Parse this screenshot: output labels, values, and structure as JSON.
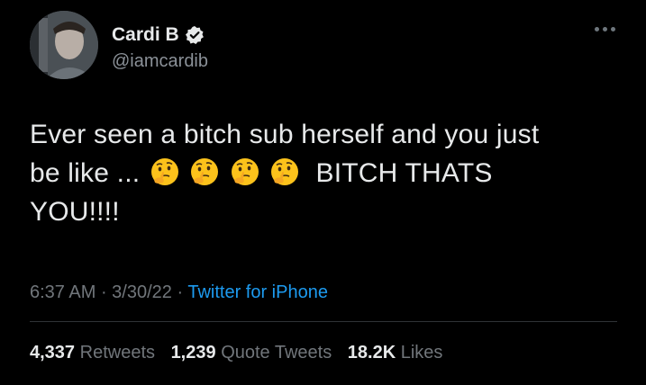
{
  "author": {
    "display_name": "Cardi B",
    "handle": "@iamcardib",
    "verified": true,
    "avatar": "avatar-photo"
  },
  "tweet": {
    "line1": "Ever seen a bitch sub herself and you just",
    "line2_prefix": "be like ...",
    "emojis": [
      "thinking-face",
      "thinking-face",
      "thinking-face",
      "thinking-face"
    ],
    "line2_suffix": " BITCH THATS",
    "line3": "YOU!!!!"
  },
  "meta": {
    "time": "6:37 AM",
    "separator": " · ",
    "date": "3/30/22",
    "source": "Twitter for iPhone"
  },
  "stats": {
    "retweets_count": "4,337",
    "retweets_label": "Retweets",
    "quotes_count": "1,239",
    "quotes_label": "Quote Tweets",
    "likes_count": "18.2K",
    "likes_label": "Likes"
  },
  "colors": {
    "background": "#000000",
    "text": "#e7e9ea",
    "secondary": "#71767b",
    "link": "#1d9bf0",
    "divider": "#2f3336"
  }
}
